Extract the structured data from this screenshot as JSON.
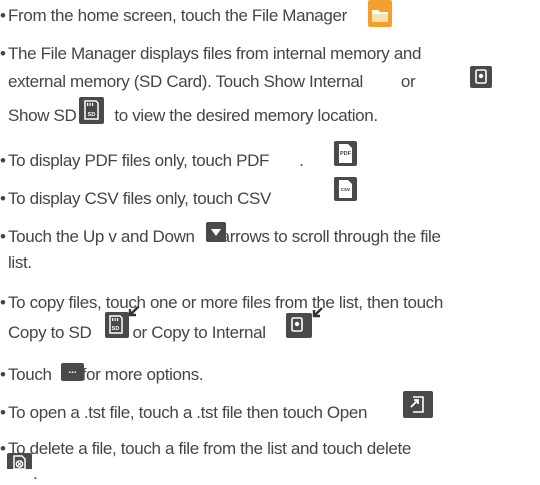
{
  "bullet": "•",
  "items": [
    {
      "id": "file-manager",
      "lines": [
        [
          "From the home screen, touch the File Manager",
          "."
        ]
      ]
    },
    {
      "id": "show-memory",
      "lines": [
        [
          "The File Manager displays files from internal memory and"
        ],
        [
          "external memory (SD Card). Touch Show Internal",
          "or"
        ],
        [
          "Show SD",
          "to view the desired memory location."
        ]
      ]
    },
    {
      "id": "pdf",
      "lines": [
        [
          "To display PDF files only, touch PDF",
          "."
        ]
      ]
    },
    {
      "id": "csv",
      "lines": [
        [
          "To display CSV files only, touch CSV"
        ]
      ]
    },
    {
      "id": "scroll",
      "lines": [
        [
          "Touch the Up v and Down",
          "arrows to scroll through the file"
        ],
        [
          "list."
        ]
      ]
    },
    {
      "id": "copy",
      "lines": [
        [
          "To copy files, touch one or more files from the list, then touch"
        ],
        [
          "Copy to SD",
          "or Copy to Internal",
          "."
        ]
      ]
    },
    {
      "id": "more",
      "lines": [
        [
          "Touch",
          "for more options."
        ]
      ]
    },
    {
      "id": "open",
      "lines": [
        [
          "To open a .tst file, touch a .tst file then touch Open",
          "."
        ]
      ]
    },
    {
      "id": "delete",
      "lines": [
        [
          "To delete a file, touch a file from the list and touch delete"
        ],
        [
          "."
        ]
      ]
    }
  ],
  "icon_labels": {
    "sd": "SD",
    "pdf": "PDF",
    "csv": "csv",
    "more": "..."
  },
  "icons": [
    "folder-icon",
    "show-internal-icon",
    "show-sd-icon",
    "pdf-icon",
    "csv-icon",
    "down-arrow-icon",
    "copy-to-sd-icon",
    "copy-to-internal-icon",
    "more-options-icon",
    "open-icon",
    "delete-icon"
  ],
  "colors": {
    "text": "#454545",
    "icon_dark": "#4a4a4a",
    "folder_orange": "#f5a22a"
  }
}
